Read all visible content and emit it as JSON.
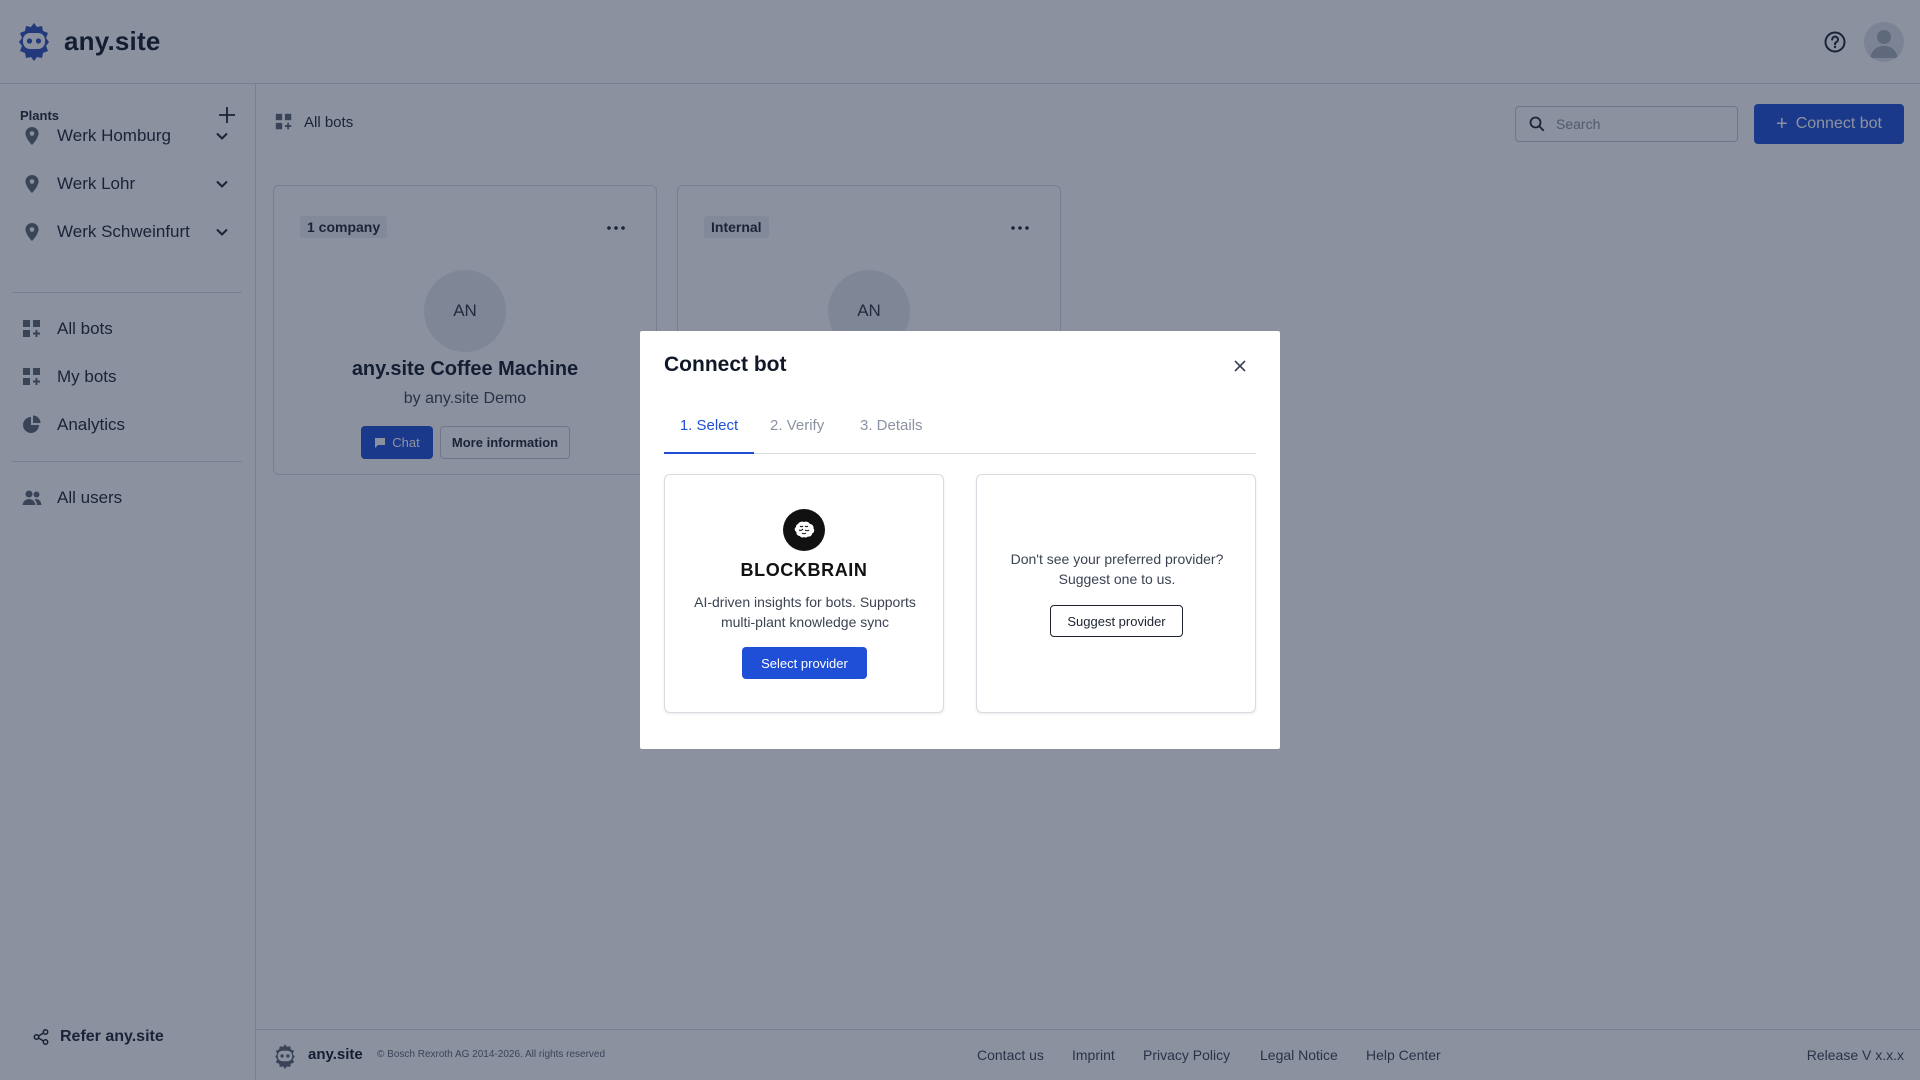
{
  "app": {
    "name": "any.site"
  },
  "colors": {
    "accent": "#1f4fd6",
    "overlay": "rgba(24,35,61,0.5)"
  },
  "header": {
    "help_icon": "help-circle-icon",
    "avatar_icon": "user-avatar-icon"
  },
  "sidebar": {
    "heading": "Plants",
    "plants": [
      {
        "label": "Werk Homburg"
      },
      {
        "label": "Werk Lohr"
      },
      {
        "label": "Werk Schweinfurt"
      }
    ],
    "nav": [
      {
        "label": "All bots",
        "icon": "grid-plus-icon"
      },
      {
        "label": "My bots",
        "icon": "grid-plus-icon"
      },
      {
        "label": "Analytics",
        "icon": "pie-chart-icon"
      },
      {
        "label": "All users",
        "icon": "users-icon"
      }
    ],
    "refer": "Refer any.site"
  },
  "main": {
    "breadcrumb": "All bots",
    "search": {
      "placeholder": "Search"
    },
    "connect_label": "Connect bot",
    "cards": [
      {
        "tag": "1 company",
        "initials": "AN",
        "title": "any.site Coffee Machine",
        "by": "by any.site Demo",
        "chat": "Chat",
        "info": "More information"
      },
      {
        "tag": "Internal",
        "initials": "AN"
      }
    ]
  },
  "footer": {
    "name": "any.site",
    "copyright": "© Bosch Rexroth AG 2014-2026. All rights reserved",
    "links": [
      "Contact us",
      "Imprint",
      "Privacy Policy",
      "Legal Notice",
      "Help Center"
    ],
    "release": "Release V x.x.x"
  },
  "modal": {
    "title": "Connect bot",
    "tabs": [
      "1. Select",
      "2. Verify",
      "3. Details"
    ],
    "provider": {
      "name": "BLOCKBRAIN",
      "description": "AI-driven insights for bots. Supports multi-plant knowledge sync",
      "select_label": "Select provider"
    },
    "suggest": {
      "message": "Don't see your preferred provider? Suggest one to us.",
      "button": "Suggest provider"
    }
  }
}
